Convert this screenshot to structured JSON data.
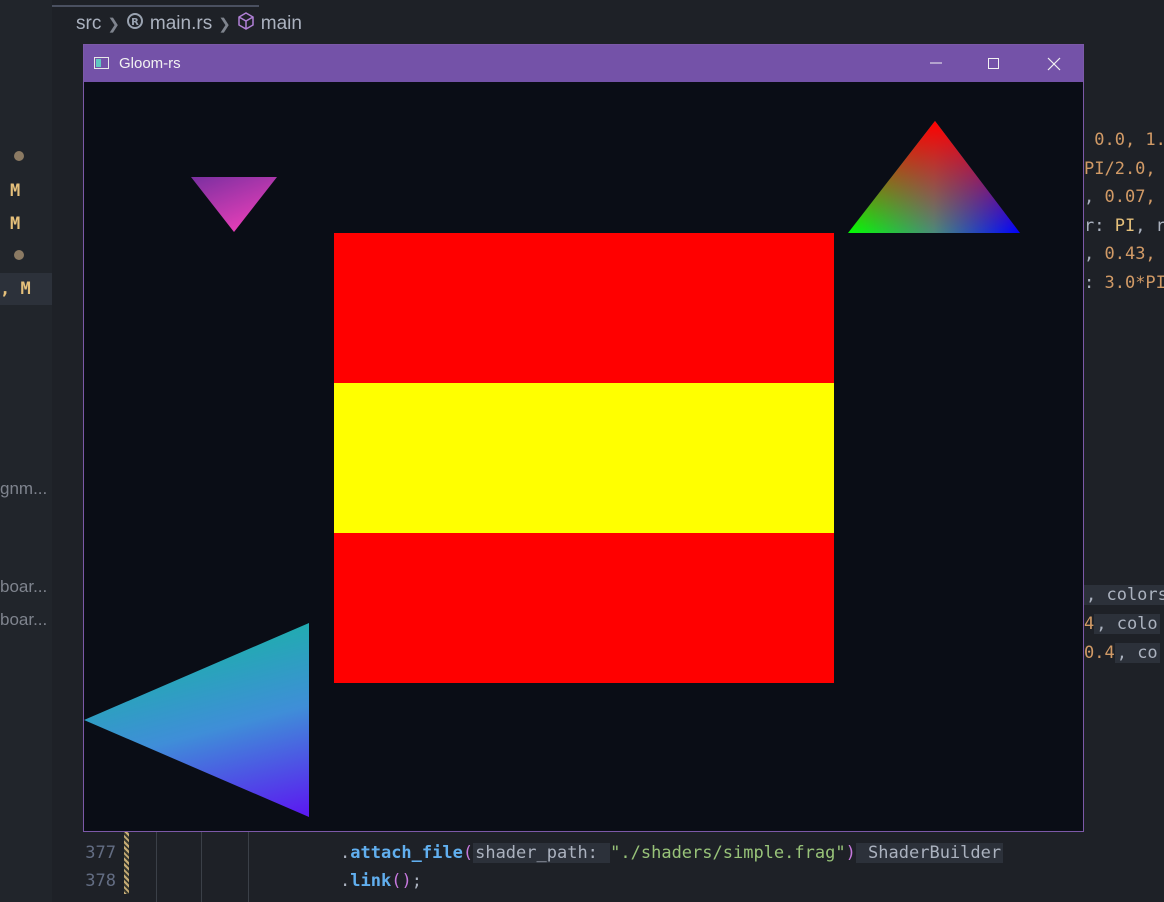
{
  "breadcrumb": {
    "folder": "src",
    "file": "main.rs",
    "symbol": "main"
  },
  "sidebar": {
    "markers": [
      "M",
      "M",
      ", M"
    ],
    "truncated_items": [
      "gnm...",
      "boar...",
      "boar..."
    ]
  },
  "editor": {
    "right_code_lines": [
      {
        "parts": [
          [
            " 0.0, 1.",
            "n"
          ]
        ]
      },
      {
        "parts": [
          [
            "PI/2.0,",
            "n"
          ]
        ]
      },
      {
        "parts": [
          [
            ", ",
            "p"
          ],
          [
            "0.07,",
            "n"
          ]
        ]
      },
      {
        "parts": [
          [
            "r: ",
            "p"
          ],
          [
            "PI",
            "k"
          ],
          [
            ", r",
            "p"
          ]
        ]
      },
      {
        "parts": [
          [
            ", ",
            "p"
          ],
          [
            "0.43,",
            "n"
          ]
        ]
      },
      {
        "parts": [
          [
            ": ",
            "p"
          ],
          [
            "3.0*PI",
            "n"
          ]
        ]
      }
    ],
    "right_code_lines_2": [
      {
        "parts": [
          [
            ", colors",
            "hint"
          ]
        ]
      },
      {
        "parts": [
          [
            "4",
            "n"
          ],
          [
            ", colo",
            "hint"
          ]
        ]
      },
      {
        "parts": [
          [
            "0.4",
            "n"
          ],
          [
            ", co",
            "hint"
          ]
        ]
      }
    ],
    "line_numbers": [
      "377",
      "378"
    ],
    "bottom_lines": [
      {
        "parts": [
          [
            ".",
            "p"
          ],
          [
            "attach_file",
            "fn"
          ],
          [
            "(",
            "par"
          ],
          [
            "shader_path: ",
            "hint"
          ],
          [
            "\"./shaders/simple.frag\"",
            "s"
          ],
          [
            ")",
            "par"
          ],
          [
            " ShaderBuilder",
            "hint"
          ]
        ]
      },
      {
        "parts": [
          [
            ".",
            "p"
          ],
          [
            "link",
            "fn"
          ],
          [
            "()",
            "par"
          ],
          [
            ";",
            "p"
          ]
        ]
      }
    ]
  },
  "window": {
    "title": "Gloom-rs",
    "icons": [
      "app-window-icon",
      "minimize-icon",
      "maximize-icon",
      "close-icon"
    ],
    "scene": {
      "shapes": [
        "magenta-gradient-triangle",
        "rgb-gradient-triangle",
        "flag-rectangle",
        "cyan-blue-gradient-triangle"
      ],
      "flag_colors": [
        "#ff0000",
        "#ffff00",
        "#ff0000"
      ]
    },
    "colors": {
      "titlebar": "#7452a8",
      "canvas": "#0a0d16"
    }
  }
}
